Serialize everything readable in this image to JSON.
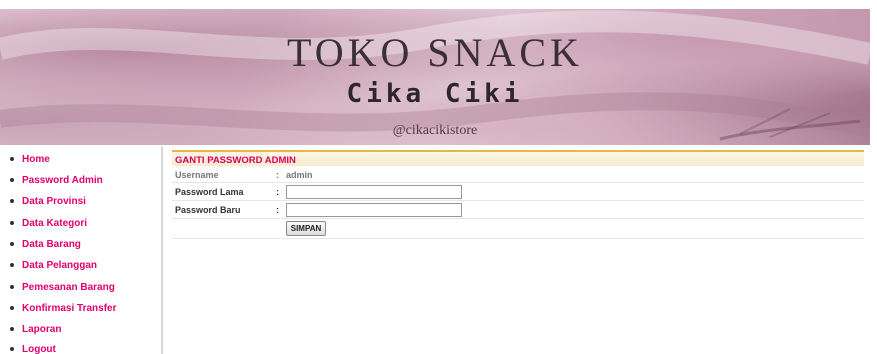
{
  "banner": {
    "title": "TOKO SNACK",
    "subtitle": "Cika Ciki",
    "handle": "@cikacikistore"
  },
  "sidebar": {
    "items": [
      {
        "label": "Home"
      },
      {
        "label": "Password Admin"
      },
      {
        "label": "Data Provinsi"
      },
      {
        "label": "Data Kategori"
      },
      {
        "label": "Data Barang"
      },
      {
        "label": "Data Pelanggan"
      },
      {
        "label": "Pemesanan Barang"
      },
      {
        "label": "Konfirmasi Transfer"
      },
      {
        "label": "Laporan"
      },
      {
        "label": "Logout"
      }
    ]
  },
  "form": {
    "heading": "GANTI PASSWORD ADMIN",
    "colon": ":",
    "username_label": "Username",
    "username_value": "admin",
    "old_password_label": "Password Lama",
    "old_password_value": "",
    "new_password_label": "Password Baru",
    "new_password_value": "",
    "submit_label": "SIMPAN"
  },
  "colors": {
    "accent": "#e0006e",
    "header_border": "#e8b74a"
  }
}
